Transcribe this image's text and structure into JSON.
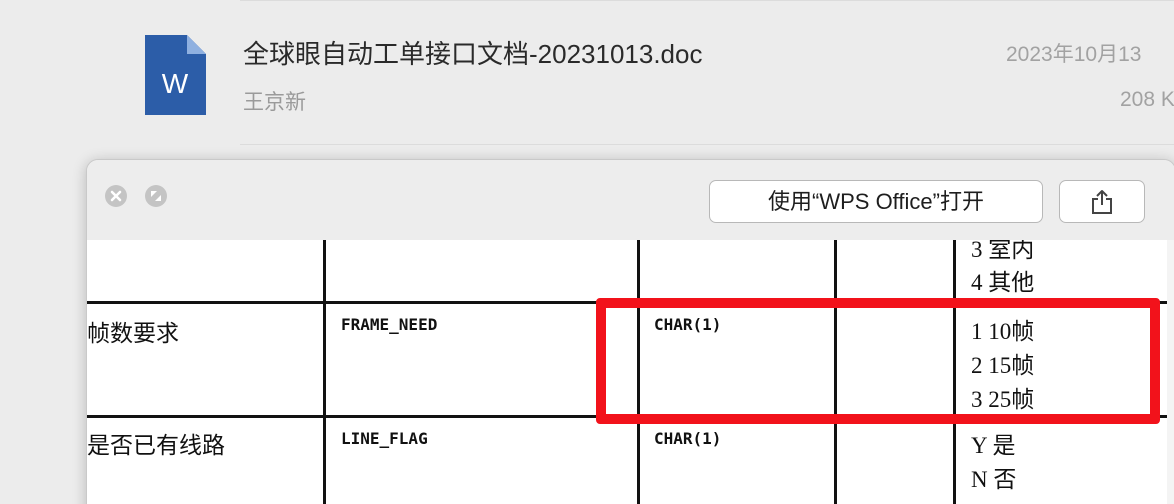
{
  "attachment": {
    "title": "全球眼自动工单接口文档-20231013.doc",
    "sender": "王京新",
    "date": "2023年10月13",
    "size": "208 K",
    "icon_letter": "W"
  },
  "quicklook": {
    "open_button_label": "使用“WPS Office”打开",
    "share_icon": "share-icon",
    "close_icon": "close-icon",
    "fullscreen_icon": "fullscreen-icon"
  },
  "table": {
    "top_row_values": [
      "3 室内",
      "4 其他"
    ],
    "rows": [
      {
        "name": "帧数要求",
        "field": "FRAME_NEED",
        "type": "CHAR(1)",
        "values": [
          "1 10帧",
          "2 15帧",
          "3 25帧"
        ]
      },
      {
        "name": "是否已有线路",
        "field": "LINE_FLAG",
        "type": "CHAR(1)",
        "values": [
          "Y  是",
          "N  否"
        ]
      }
    ]
  },
  "colors": {
    "highlight": "#f2121b",
    "word_icon": "#2c5da8"
  }
}
